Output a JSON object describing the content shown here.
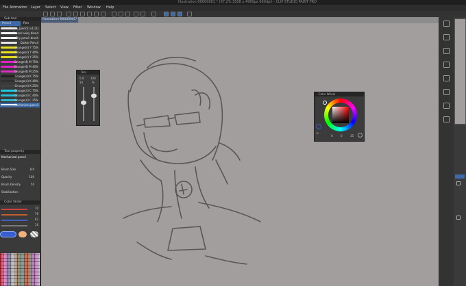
{
  "window": {
    "title": "Illustration-00000001 * (67.2% 3508 x 4960px 600dpi) - CLIP STUDIO PAINT PRO"
  },
  "menu": [
    "File",
    "Animation",
    "Layer",
    "Select",
    "View",
    "Filter",
    "Window",
    "Help"
  ],
  "document": {
    "tab": "Illustration-00000001*"
  },
  "left_panel": {
    "sub_tool_title": "Sub tool",
    "tabs": [
      "Pencil",
      "Pen"
    ],
    "brushes": [
      {
        "name": "Brush_(pencil) v1 (1)",
        "color": "#e8e8e8"
      },
      {
        "name": "Round noisy blend",
        "color": "#f0f0f0"
      },
      {
        "name": "Dry pencil brush",
        "color": "#f0f0f0"
      },
      {
        "name": "Darker Pencil",
        "color": "#e6e6e6"
      },
      {
        "name": "Grunge(4) Y 75%",
        "color": "#e6e020"
      },
      {
        "name": "Grunge(4) Y 40%",
        "color": "#e8e020"
      },
      {
        "name": "Grunge(4) Y 25%",
        "color": "#e0d820"
      },
      {
        "name": "Grunge(4) M 75%",
        "color": "#e020c8"
      },
      {
        "name": "Grunge(4) M 40%",
        "color": "#e020c8"
      },
      {
        "name": "Grunge(4) M 25%",
        "color": "#d830c0"
      },
      {
        "name": "Grunge(4) K 75%",
        "color": "#202020"
      },
      {
        "name": "Grunge(4) K 40%",
        "color": "#303030"
      },
      {
        "name": "Grunge(4) K 25%",
        "color": "#404040"
      },
      {
        "name": "Grunge(4) C 75%",
        "color": "#20c8e0"
      },
      {
        "name": "Grunge(4) C 40%",
        "color": "#20c0d8"
      },
      {
        "name": "Grunge(4) C 25%",
        "color": "#30b8d0"
      },
      {
        "name": "Mechanical pencil",
        "color": "#ffffff"
      }
    ],
    "tool_property_title": "Tool property",
    "tool_name": "Mechanical pencil",
    "properties": [
      {
        "label": "Brush Size",
        "value": "8.0"
      },
      {
        "label": "Opacity",
        "value": "100"
      },
      {
        "label": "Brush Density",
        "value": "50"
      },
      {
        "label": "Stabilization",
        "value": ""
      }
    ],
    "color_slider_title": "Color Slider",
    "sliders": [
      {
        "value": "70",
        "color": "#d04040"
      },
      {
        "value": "76",
        "color": "#c06030"
      },
      {
        "value": "62",
        "color": "#4060c0"
      },
      {
        "value": "16",
        "color": "#7a7a7a"
      }
    ],
    "main_color": "#3a5fd0",
    "sub_color": "#f0b080"
  },
  "tool_window": {
    "title": "Tool",
    "values": [
      "0.0",
      "24",
      "100",
      "%"
    ]
  },
  "color_wheel": {
    "title": "Color Wheel",
    "values": [
      "0",
      "0",
      "35"
    ]
  }
}
